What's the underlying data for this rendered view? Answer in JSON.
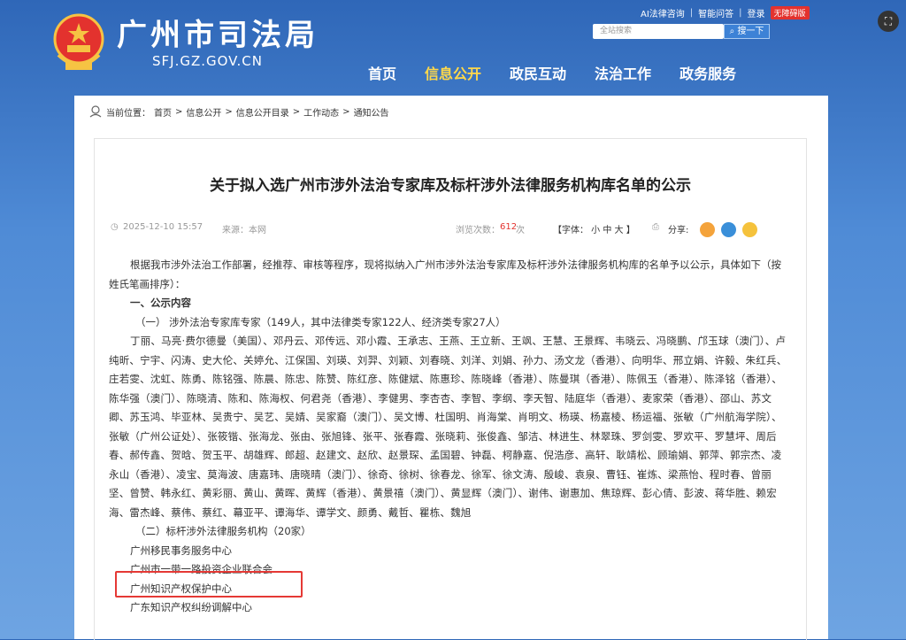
{
  "header": {
    "site_title": "广州市司法局",
    "site_domain": "SFJ.GZ.GOV.CN",
    "toplinks": [
      "AI法律咨询",
      "智能问答",
      "登录"
    ],
    "badge": "无障碍版",
    "search_placeholder": "全站搜索",
    "search_button": "搜一下"
  },
  "nav": {
    "items": [
      "首页",
      "信息公开",
      "政民互动",
      "法治工作",
      "政务服务"
    ],
    "active_index": 1
  },
  "breadcrumb": {
    "prefix": "当前位置：",
    "items": [
      "首页",
      "信息公开",
      "信息公开目录",
      "工作动态",
      "通知公告"
    ]
  },
  "article": {
    "title": "关于拟入选广州市涉外法治专家库及标杆涉外法律服务机构库名单的公示",
    "date": "2025-12-10 15:57",
    "source": "来源：本网",
    "views_label": "浏览次数：",
    "views_count": "612",
    "views_unit": "次",
    "font_size": "【字体： 小 中 大 】",
    "share_label": "分享:",
    "intro": "根据我市涉外法治工作部署，经推荐、审核等程序，现将拟纳入广州市涉外法治专家库及标杆涉外法律服务机构库的名单予以公示，具体如下（按姓氏笔画排序）：",
    "section1": "一、公示内容",
    "sub1": "（一） 涉外法治专家库专家（149人，其中法律类专家122人、经济类专家27人）",
    "names": "丁丽、马亮·费尔德曼（美国）、邓丹云、邓传远、邓小霞、王承志、王燕、王立新、王飒、王慧、王景辉、韦晓云、冯晓鹏、邝玉球（澳门）、卢纯昕、宁宇、闪涛、史大伦、关婷允、江保国、刘瑛、刘羿、刘颖、刘春晓、刘洋、刘娟、孙力、汤文龙（香港）、向明华、邢立娟、许毅、朱红兵、庄若雯、沈虹、陈勇、陈铭强、陈晨、陈忠、陈赞、陈红彦、陈健斌、陈惠珍、陈晓峰（香港）、陈曼琪（香港）、陈佩玉（香港）、陈泽铭（香港）、陈华强（澳门）、陈晓清、陈和、陈海权、何君尧（香港）、李健男、李杏杏、李智、李纲、李天智、陆庭华（香港）、麦家荣（香港）、邵山、苏文卿、苏玉鸿、毕亚林、吴贵宁、吴艺、吴婧、吴家裔（澳门）、吴文博、杜国明、肖海棠、肖明文、杨瑛、杨嘉棱、杨运福、张敏（广州航海学院）、张敏（广州公证处）、张筱锴、张海龙、张由、张旭锋、张平、张春霞、张晓莉、张俊鑫、邹洁、林进生、林翠珠、罗剑雯、罗欢平、罗慧坪、周后春、郝传鑫、贺晗、贺玉平、胡雄辉、郎超、赵建文、赵欣、赵景琛、孟国碧、钟磊、柯静嘉、倪浩彦、高轩、耿靖松、顾瑜娟、郭萍、郭宗杰、凌永山（香港）、凌宝、莫海波、唐嘉玮、唐晓晴（澳门）、徐奇、徐树、徐春龙、徐军、徐文涛、殷峻、袁泉、曹钰、崔炼、梁燕怡、程时春、曾丽坚、曾赞、韩永红、黄彩丽、黄山、黄晖、黄辉（香港）、黄景禧（澳门）、黄显辉（澳门）、谢伟、谢惠加、焦琼辉、彭心倩、彭波、蒋华胜、赖宏海、雷杰峰、蔡伟、蔡红、幕亚平、谭海华、谭学文、颜勇、戴哲、瞿栋、魏旭",
    "sub2": "（二）标杆涉外法律服务机构（20家）",
    "orgs": [
      "广州移民事务服务中心",
      "广州市一带一路投资企业联合会",
      "广州知识产权保护中心",
      "广东知识产权纠纷调解中心"
    ]
  }
}
